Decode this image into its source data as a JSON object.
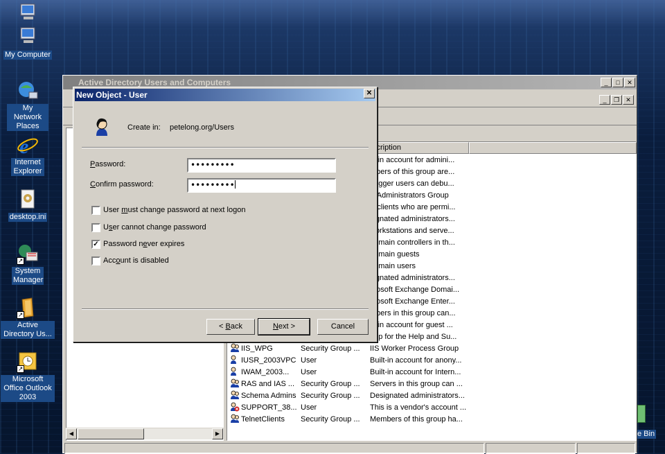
{
  "desktop": {
    "icons": [
      {
        "label": "My Computer",
        "icon": "computer-icon"
      },
      {
        "label": "My Network Places",
        "icon": "network-icon"
      },
      {
        "label": "Internet Explorer",
        "icon": "ie-icon"
      },
      {
        "label": "desktop.ini",
        "icon": "file-icon"
      },
      {
        "label": "System Manager",
        "icon": "system-manager-icon"
      },
      {
        "label": "Active Directory Us...",
        "icon": "ad-icon"
      },
      {
        "label": "Microsoft Office Outlook 2003",
        "icon": "outlook-icon"
      }
    ],
    "recycle_bin_label": "e Bin"
  },
  "ad_window": {
    "title": "Active Directory Users and Computers",
    "column_description": "scription",
    "rows": [
      {
        "name": "",
        "type": "",
        "desc": "ilt-in account for admini..."
      },
      {
        "name": "",
        "type": "",
        "desc": "mbers of this group are..."
      },
      {
        "name": "",
        "type": "",
        "desc": "bugger users can debu..."
      },
      {
        "name": "",
        "type": "",
        "desc": "S Administrators Group"
      },
      {
        "name": "",
        "type": "",
        "desc": "S clients who are permi..."
      },
      {
        "name": "",
        "type": "",
        "desc": "signated administrators..."
      },
      {
        "name": "",
        "type": "",
        "desc": "workstations and serve..."
      },
      {
        "name": "",
        "type": "",
        "desc": "domain controllers in th..."
      },
      {
        "name": "",
        "type": "",
        "desc": "domain guests"
      },
      {
        "name": "",
        "type": "",
        "desc": "domain users"
      },
      {
        "name": "",
        "type": "",
        "desc": "signated administrators..."
      },
      {
        "name": "",
        "type": "",
        "desc": "crosoft Exchange Domai..."
      },
      {
        "name": "",
        "type": "",
        "desc": "crosoft Exchange Enter..."
      },
      {
        "name": "",
        "type": "",
        "desc": "mbers in this group can..."
      },
      {
        "name": "",
        "type": "",
        "desc": "ilt-in account for guest ..."
      },
      {
        "name": "",
        "type": "",
        "desc": "oup for the Help and Su..."
      },
      {
        "name": "IIS_WPG",
        "type": "Security Group ...",
        "desc": "IIS Worker Process Group"
      },
      {
        "name": "IUSR_2003VPC",
        "type": "User",
        "desc": "Built-in account for anony..."
      },
      {
        "name": "IWAM_2003...",
        "type": "User",
        "desc": "Built-in account for Intern..."
      },
      {
        "name": "RAS and IAS ...",
        "type": "Security Group ...",
        "desc": "Servers in this group can ..."
      },
      {
        "name": "Schema Admins",
        "type": "Security Group ...",
        "desc": "Designated administrators..."
      },
      {
        "name": "SUPPORT_38...",
        "type": "User",
        "desc": "This is a vendor's account ..."
      },
      {
        "name": "TelnetClients",
        "type": "Security Group ...",
        "desc": "Members of this group ha..."
      }
    ]
  },
  "dialog": {
    "title": "New Object - User",
    "create_in_label": "Create in:",
    "create_in_value": "petelong.org/Users",
    "password_label": "Password:",
    "password_value": "•••••••••",
    "confirm_label": "Confirm password:",
    "confirm_value": "•••••••••",
    "checkboxes": [
      {
        "label": "User must change password at next logon",
        "checked": false
      },
      {
        "label": "User cannot change password",
        "checked": false
      },
      {
        "label": "Password never expires",
        "checked": true
      },
      {
        "label": "Account is disabled",
        "checked": false
      }
    ],
    "back_label": "< Back",
    "next_label": "Next >",
    "cancel_label": "Cancel",
    "close_glyph": "✕"
  }
}
